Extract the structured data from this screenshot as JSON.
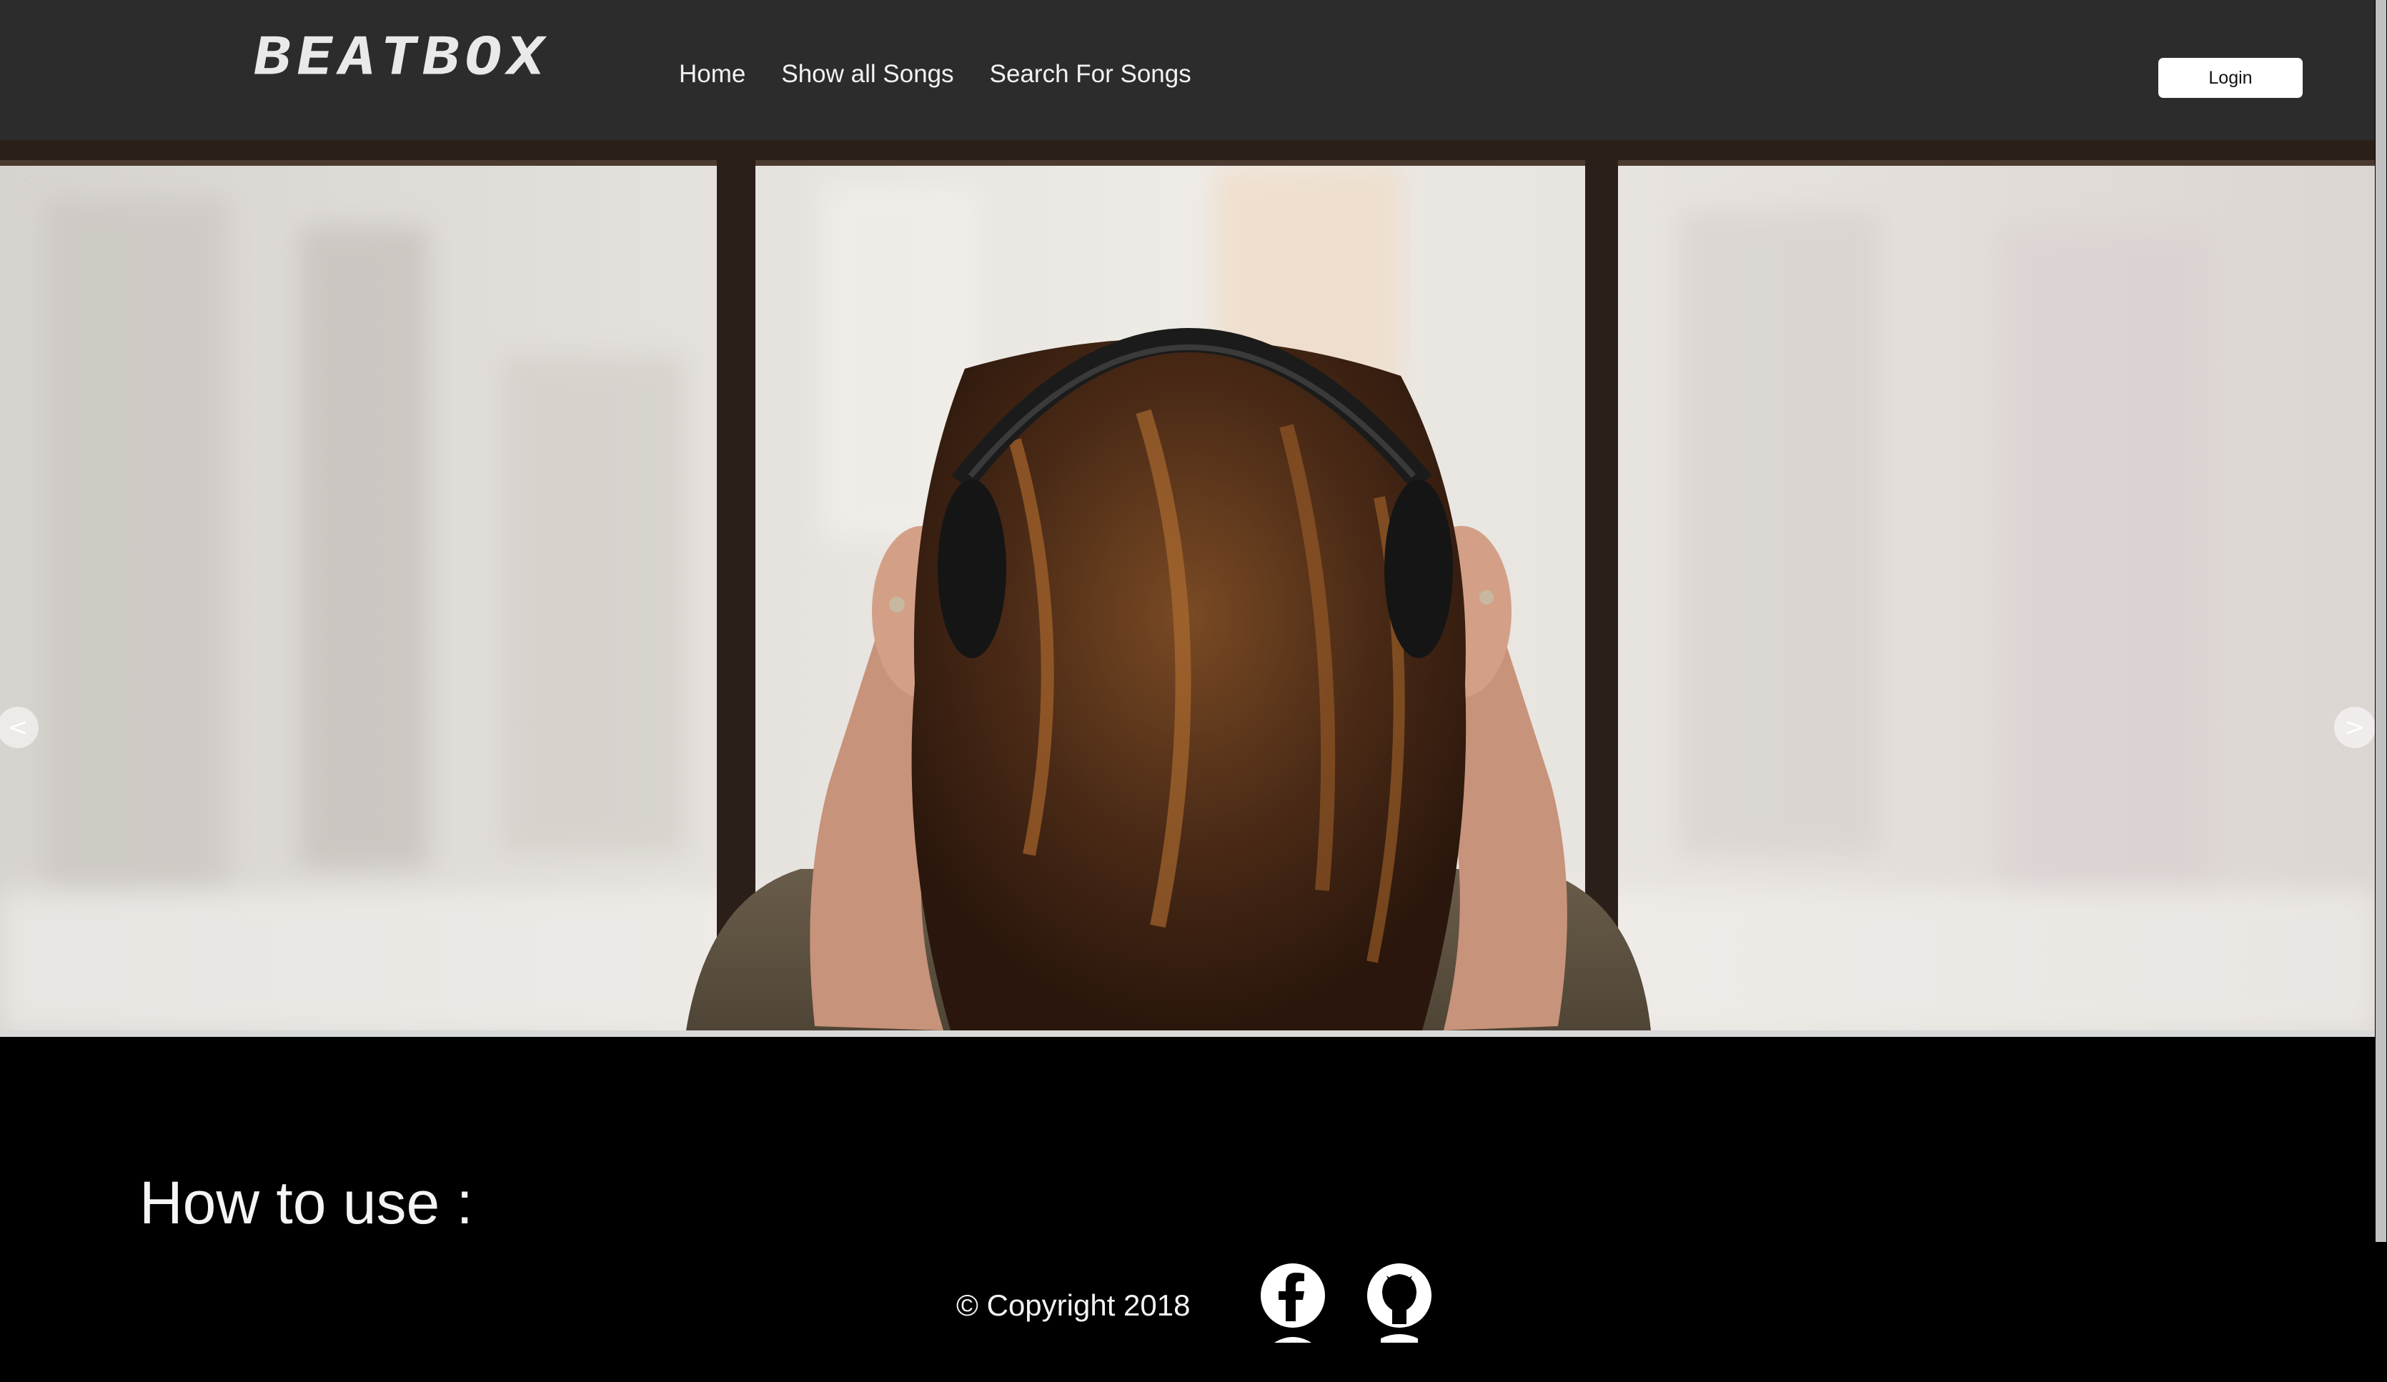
{
  "navbar": {
    "logo_text": "BEATBOX",
    "links": [
      {
        "label": "Home"
      },
      {
        "label": "Show all Songs"
      },
      {
        "label": "Search For Songs"
      }
    ],
    "login_label": "Login"
  },
  "hero": {
    "prev_arrow": "<",
    "next_arrow": ">"
  },
  "howto": {
    "title": "How to use :"
  },
  "footer": {
    "copyright": "© Copyright 2018",
    "social": [
      {
        "icon": "facebook-icon"
      },
      {
        "icon": "github-icon"
      }
    ]
  },
  "colors": {
    "navbar_bg": "#2d2c2c",
    "page_bg": "#000000",
    "text": "#f2f2f2"
  }
}
